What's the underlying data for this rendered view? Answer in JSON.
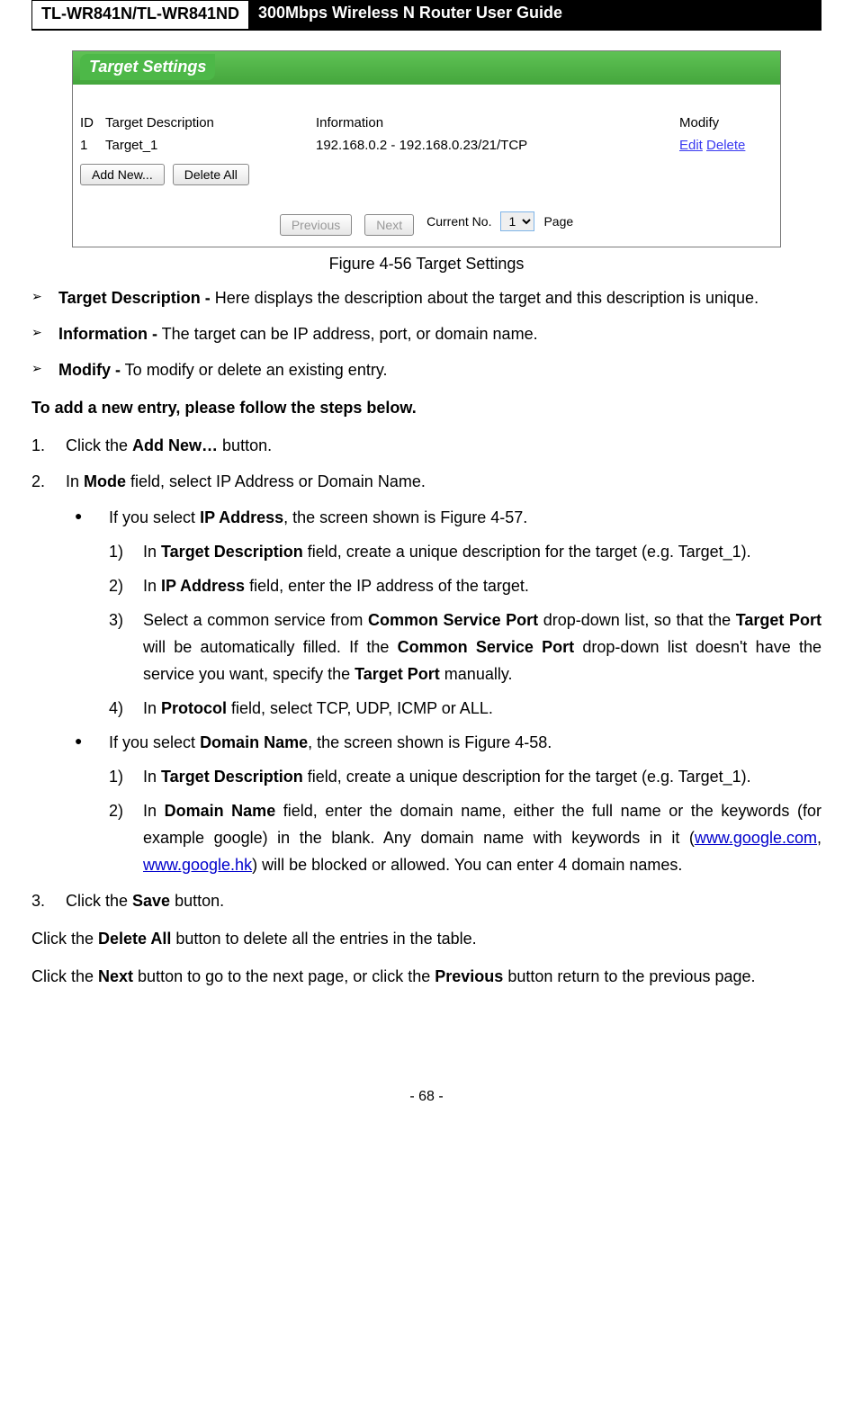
{
  "header": {
    "model": "TL-WR841N/TL-WR841ND",
    "title": "300Mbps Wireless N Router User Guide"
  },
  "screenshot": {
    "title": "Target Settings",
    "columns": {
      "id": "ID",
      "desc": "Target Description",
      "info": "Information",
      "modify": "Modify"
    },
    "row": {
      "id": "1",
      "desc": "Target_1",
      "info": "192.168.0.2 - 192.168.0.23/21/TCP",
      "edit": "Edit",
      "delete": "Delete"
    },
    "buttons": {
      "add": "Add New...",
      "deleteAll": "Delete All",
      "previous": "Previous",
      "next": "Next"
    },
    "pager": {
      "currentLabel": "Current No.",
      "value": "1",
      "page": "Page"
    }
  },
  "caption": "Figure 4-56    Target Settings",
  "bullets": {
    "b1_label": "Target Description -",
    "b1_text": " Here displays the description about the target and this description is unique.",
    "b2_label": "Information -",
    "b2_text": " The target can be IP address, port, or domain name.",
    "b3_label": "Modify -",
    "b3_text": " To modify or delete an existing entry."
  },
  "heading_add": "To add a new entry, please follow the steps below.",
  "steps": {
    "s1_a": "Click the ",
    "s1_b": "Add New…",
    "s1_c": " button.",
    "s2_a": "In ",
    "s2_b": "Mode",
    "s2_c": " field, select IP Address or Domain Name.",
    "s3_a": "Click the ",
    "s3_b": "Save",
    "s3_c": " button."
  },
  "ip_branch": {
    "intro_a": "If you select ",
    "intro_b": "IP Address",
    "intro_c": ", the screen shown is Figure 4-57.",
    "i1_a": "In ",
    "i1_b": "Target Description",
    "i1_c": " field, create a unique description for the target (e.g. Target_1).",
    "i2_a": "In ",
    "i2_b": "IP Address",
    "i2_c": " field, enter the IP address of the target.",
    "i3_a": "Select a common service from ",
    "i3_b": "Common Service Port",
    "i3_c": " drop-down list, so that the ",
    "i3_d": "Target Port",
    "i3_e": " will be automatically filled. If the ",
    "i3_f": "Common Service Port",
    "i3_g": " drop-down list doesn't have the service you want, specify the ",
    "i3_h": "Target Port",
    "i3_i": " manually.",
    "i4_a": "In ",
    "i4_b": "Protocol",
    "i4_c": " field, select TCP, UDP, ICMP or ALL."
  },
  "dn_branch": {
    "intro_a": "If you select ",
    "intro_b": "Domain Name",
    "intro_c": ", the screen shown is Figure 4-58.",
    "d1_a": "In ",
    "d1_b": "Target Description",
    "d1_c": " field, create a unique description for the target (e.g. Target_1).",
    "d2_a": "In ",
    "d2_b": "Domain Name",
    "d2_c": " field, enter the domain name, either the full name or the keywords (for example google) in the blank. Any domain name with keywords in it (",
    "d2_link1": "www.google.com",
    "d2_d": ", ",
    "d2_link2": "www.google.hk",
    "d2_e": ") will be blocked or allowed. You can enter 4 domain names."
  },
  "tail": {
    "p1_a": "Click the ",
    "p1_b": "Delete All",
    "p1_c": " button to delete all the entries in the table.",
    "p2_a": "Click the ",
    "p2_b": "Next",
    "p2_c": " button to go to the next page, or click the ",
    "p2_d": "Previous",
    "p2_e": " button return to the previous page."
  },
  "footer": "- 68 -"
}
